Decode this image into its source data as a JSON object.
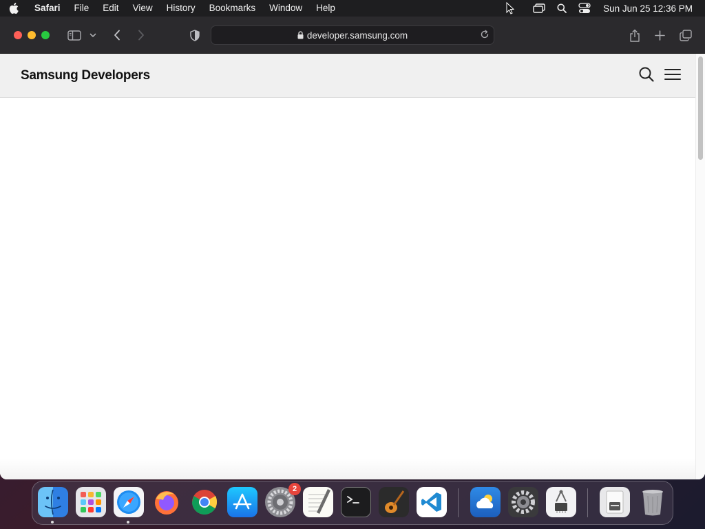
{
  "menubar": {
    "app_name": "Safari",
    "items": [
      "File",
      "Edit",
      "View",
      "History",
      "Bookmarks",
      "Window",
      "Help"
    ],
    "clock": "Sun Jun 25  12:36 PM"
  },
  "browser": {
    "url": "developer.samsung.com"
  },
  "site": {
    "logo_text": "Samsung Developers"
  },
  "dock": {
    "apps": [
      {
        "name": "Finder",
        "icon": "finder-icon",
        "running": true
      },
      {
        "name": "Launchpad",
        "icon": "launchpad-icon",
        "running": false
      },
      {
        "name": "Safari",
        "icon": "safari-icon",
        "running": true
      },
      {
        "name": "Firefox",
        "icon": "firefox-icon",
        "running": false
      },
      {
        "name": "Chrome",
        "icon": "chrome-icon",
        "running": false
      },
      {
        "name": "App Store",
        "icon": "app-store-icon",
        "running": false
      },
      {
        "name": "System Preferences",
        "icon": "system-preferences-icon",
        "running": false,
        "badge": "2"
      },
      {
        "name": "TextEdit",
        "icon": "textedit-icon",
        "running": false
      },
      {
        "name": "Terminal",
        "icon": "terminal-icon",
        "running": false
      },
      {
        "name": "GarageBand",
        "icon": "garageband-icon",
        "running": false
      },
      {
        "name": "Visual Studio Code",
        "icon": "vscode-icon",
        "running": false
      },
      {
        "name": "Weather",
        "icon": "weather-icon",
        "running": false
      },
      {
        "name": "Utility",
        "icon": "gear-app-icon",
        "running": false
      },
      {
        "name": "System Information",
        "icon": "system-information-icon",
        "running": false
      },
      {
        "name": "Downloads",
        "icon": "downloads-stack-icon",
        "running": false
      },
      {
        "name": "Trash",
        "icon": "trash-icon",
        "running": false
      }
    ]
  }
}
